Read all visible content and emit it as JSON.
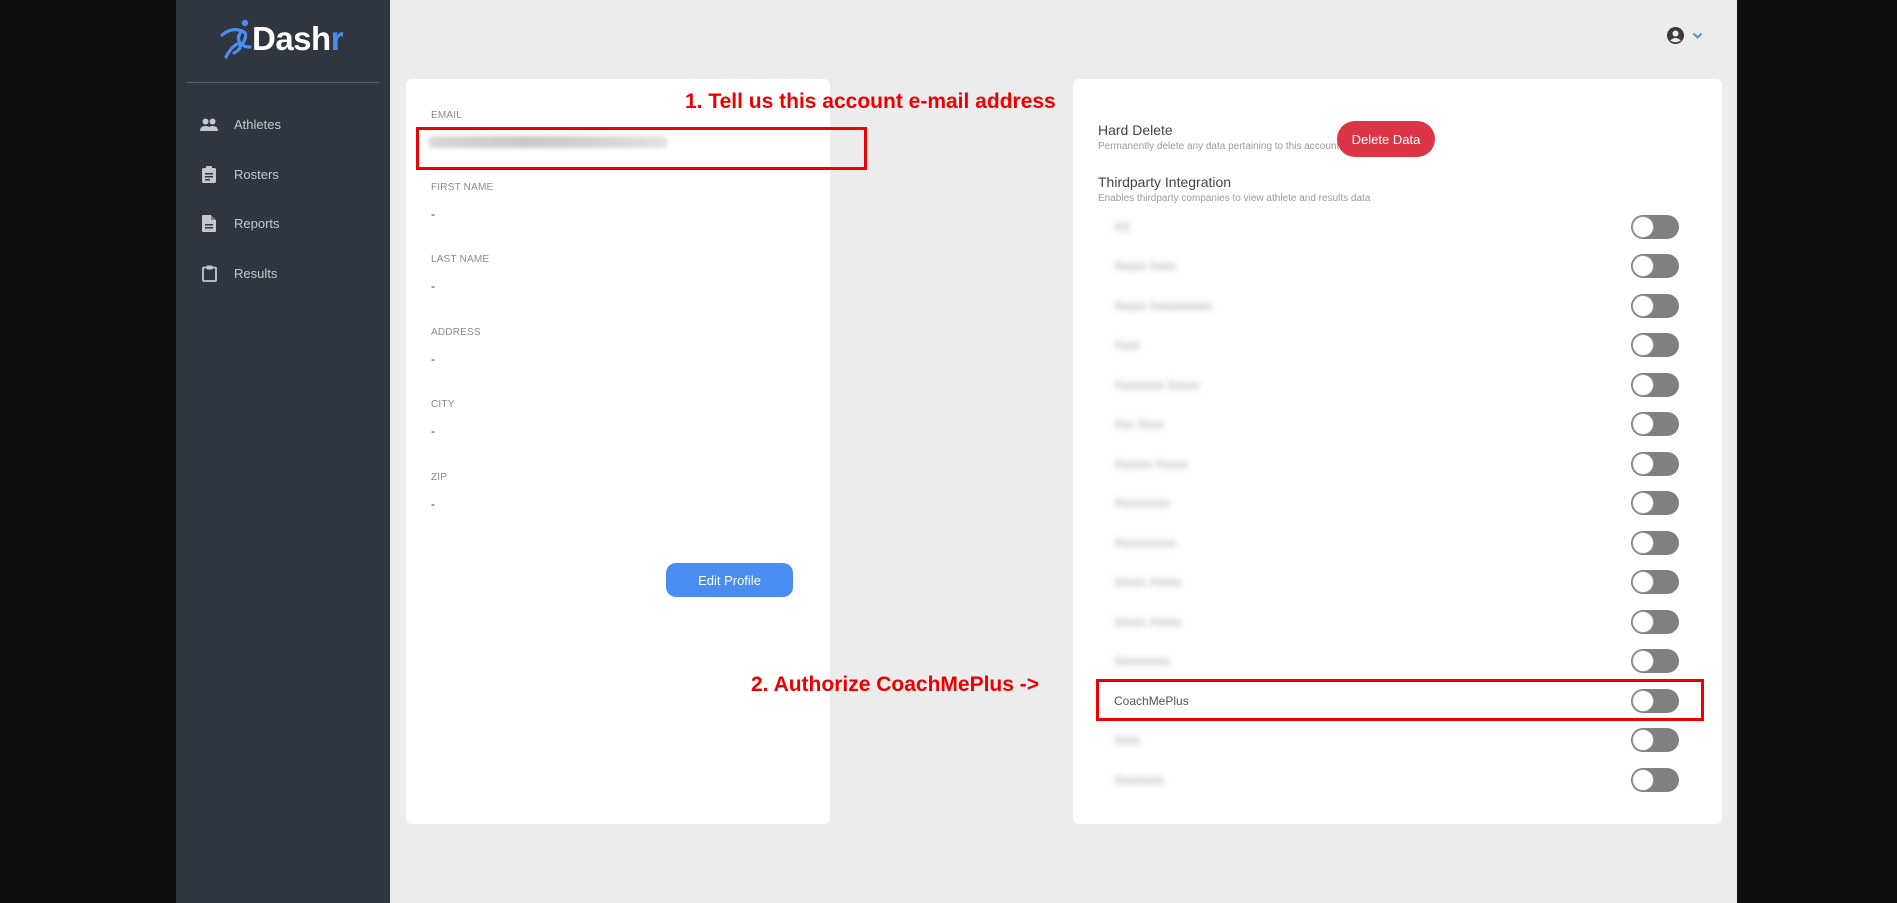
{
  "brand": {
    "name_main": "Dash",
    "name_accent": "r",
    "accent_color": "#4a8df0"
  },
  "sidebar": {
    "items": [
      {
        "label": "Athletes",
        "icon": "people-icon"
      },
      {
        "label": "Rosters",
        "icon": "clipboard-list-icon"
      },
      {
        "label": "Reports",
        "icon": "file-text-icon"
      },
      {
        "label": "Results",
        "icon": "clipboard-icon"
      }
    ]
  },
  "header": {
    "user_icon": "user-circle-icon",
    "dropdown_icon": "chevron-down-icon"
  },
  "profile": {
    "fields": [
      {
        "label": "EMAIL",
        "value": ""
      },
      {
        "label": "FIRST NAME",
        "value": "-"
      },
      {
        "label": "LAST NAME",
        "value": "-"
      },
      {
        "label": "ADDRESS",
        "value": "-"
      },
      {
        "label": "CITY",
        "value": "-"
      },
      {
        "label": "ZIP",
        "value": "-"
      }
    ],
    "email_blurred": true,
    "edit_button": "Edit Profile"
  },
  "settings": {
    "hard_delete": {
      "title": "Hard Delete",
      "subtitle": "Permanently delete any data pertaining to this account",
      "button": "Delete Data",
      "button_color": "#dc3545"
    },
    "integration": {
      "title": "Thirdparty Integration",
      "subtitle": "Enables thirdparty companies to view athlete and results data",
      "items": [
        {
          "label": "XX",
          "blurred": true,
          "enabled": false
        },
        {
          "label": "Xxxxx Xxxx",
          "blurred": true,
          "enabled": false
        },
        {
          "label": "Xxxxx Xxxxxxxxxn",
          "blurred": true,
          "enabled": false
        },
        {
          "label": "Xxxx",
          "blurred": true,
          "enabled": false
        },
        {
          "label": "Xxxxxxxx Xxxxx",
          "blurred": true,
          "enabled": false
        },
        {
          "label": "Xxx Xxxx",
          "blurred": true,
          "enabled": false
        },
        {
          "label": "Xxxxxx Xxxxx",
          "blurred": true,
          "enabled": false
        },
        {
          "label": "Xxxxxxxxx",
          "blurred": true,
          "enabled": false
        },
        {
          "label": "Xxxxxxxxxx",
          "blurred": true,
          "enabled": false
        },
        {
          "label": "Xxxxx Xxxxx",
          "blurred": true,
          "enabled": false
        },
        {
          "label": "Xxxxx Xxxxx",
          "blurred": true,
          "enabled": false
        },
        {
          "label": "Xxxxxxxxx",
          "blurred": true,
          "enabled": false
        },
        {
          "label": "CoachMePlus",
          "blurred": false,
          "enabled": false
        },
        {
          "label": "Xxxx",
          "blurred": true,
          "enabled": false
        },
        {
          "label": "Xxxxxxxx",
          "blurred": true,
          "enabled": false
        }
      ]
    }
  },
  "annotations": {
    "step1": "1. Tell us this account e-mail address",
    "step2": "2. Authorize CoachMePlus ->",
    "color": "#ee0000"
  }
}
